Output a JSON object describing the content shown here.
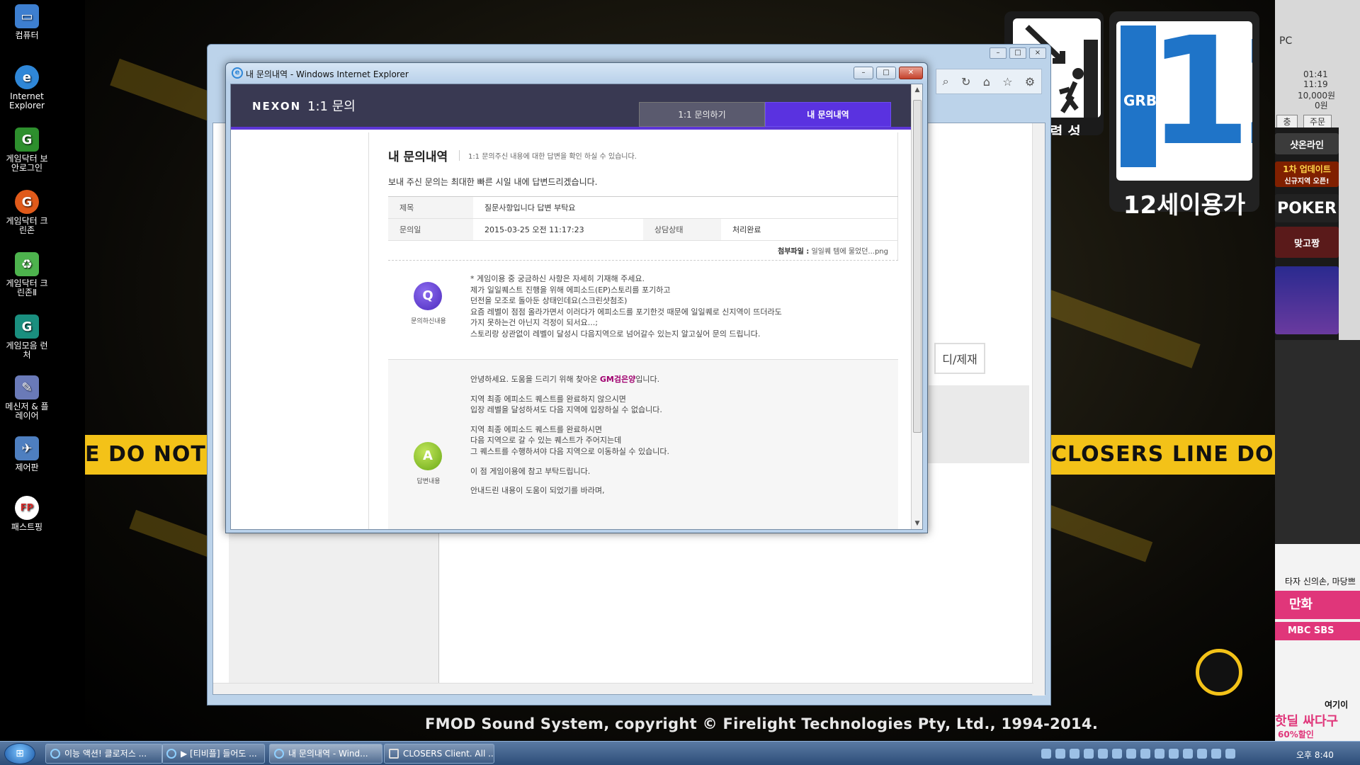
{
  "desktop": {
    "icons": [
      {
        "label": "컴퓨터",
        "color": "#3d7fd0",
        "glyph": "▭"
      },
      {
        "label": "Internet Explorer",
        "color": "#2f87d8",
        "glyph": "e"
      },
      {
        "label": "게임닥터 보안로그인",
        "color": "#2d8f2d",
        "glyph": "G"
      },
      {
        "label": "게임닥터 크린존",
        "color": "#e05a1a",
        "glyph": "G"
      },
      {
        "label": "게임닥터 크린존Ⅱ",
        "color": "#4db34d",
        "glyph": "♻"
      },
      {
        "label": "게임모음 런처",
        "color": "#1a8f7f",
        "glyph": "G"
      },
      {
        "label": "메신저 & 플레이어",
        "color": "#6a7ab8",
        "glyph": "✎"
      },
      {
        "label": "제어판",
        "color": "#4e7fc0",
        "glyph": "✈"
      },
      {
        "label": "패스트핑",
        "color": "#d02a2a",
        "glyph": "FP"
      }
    ],
    "tape_left": "E DO NOT CRO",
    "tape_right": "CLOSERS LINE DO NOT CR",
    "fmod_text": "FMOD Sound System, copyright © Firelight Technologies Pty, Ltd., 1994-2014.",
    "rating_age_label": "12세이용가",
    "rating_org": "GRB",
    "rating_number": "12",
    "violence_label": "력 성"
  },
  "side_panel": {
    "pc_label": "PC",
    "time1": "01:41",
    "time2": "11:19",
    "price": "10,000원",
    "zero": "0원",
    "btn1": "충",
    "btn2": "주문",
    "item1": "샷온라인",
    "item2": "1차 업데이트",
    "item2_sub": "신규지역 오픈!",
    "item3": "POKER",
    "item4": "맞고짱",
    "bottom_text": "타자 신의손, 마당쁘",
    "bottom_btn": "만화",
    "bottom_brand": "MBC SBS",
    "bottom_ad1": "여기이",
    "bottom_ad2": "핫딜 싸다구",
    "bottom_ad3": "60%할인"
  },
  "bg_window": {
    "nav_pill": "디/제재"
  },
  "popup": {
    "window_title": "내 문의내역 - Windows Internet Explorer",
    "brand": "NEXON",
    "service": "1:1 문의",
    "tabs": {
      "ask": "1:1 문의하기",
      "history": "내 문의내역"
    },
    "page_title": "내 문의내역",
    "page_desc": "1:1 문의주신 내용에 대한 답변을 확인 하실 수 있습니다.",
    "notice": "보내 주신 문의는 최대한 빠른 시일 내에 답변드리겠습니다.",
    "table": {
      "subject_label": "제목",
      "subject_value": "질문사항입니다 답변 부탁요",
      "date_label": "문의일",
      "date_value": "2015-03-25 오전 11:17:23",
      "status_label": "상담상태",
      "status_value": "처리완료"
    },
    "attach_label": "첨부파일 :",
    "attach_value": "일일퀘 템에 물었던...png",
    "question": {
      "badge": "Q",
      "label": "문의하신내용",
      "lines": [
        "* 게임이용 중 궁금하신 사항은 자세히 기재해 주세요.",
        "제가 일일퀘스트 진행을 위해 에피소드(EP)스토리를 포기하고",
        "던전을 모조로 돌아둔 상태인데요(스크린샷첨조)",
        "요즘 레벨이 점점 올라가면서 이러다가 에피소드를 포기한것 때문에 일일퀘로 신지역이 뜨더라도",
        "가지 못하는건 아닌지 걱정이 되서요...;",
        "스토리랑 상관없이 레벨이 달성시 다음지역으로 넘어갈수 있는지 알고싶어 문의 드립니다."
      ]
    },
    "answer": {
      "badge": "A",
      "label": "답변내용",
      "greeting_pre": "안녕하세요. 도움을 드리기 위해 찾아온 ",
      "greeting_gm": "GM검은양",
      "greeting_post": "입니다.",
      "p1": [
        "지역 최종 에피소드 퀘스트를 완료하지 않으시면",
        "입장 레벨을 달성하셔도 다음 지역에 입장하실 수 없습니다."
      ],
      "p2": [
        "지역 최종 에피소드 퀘스트를 완료하시면",
        "다음 지역으로 갈 수 있는 퀘스트가 주어지는데",
        "그 퀘스트를 수행하셔야 다음 지역으로 이동하실 수 있습니다."
      ],
      "p3": "이 점 게임이용에 참고 부탁드립니다.",
      "p4": "안내드린 내용이 도움이 되었기를 바라며,"
    }
  },
  "taskbar": {
    "start_label": "⊞",
    "tasks": [
      "이능 액션! 클로저스 ...",
      "▶ [티비플] 들어도 ...",
      "내 문의내역 - Wind...",
      "CLOSERS Client. All ..."
    ],
    "clock": "오후 8:40"
  },
  "colors": {
    "accent_purple": "#5a32e0",
    "answer_green": "#69a814",
    "tape_yellow": "#f3c218"
  }
}
